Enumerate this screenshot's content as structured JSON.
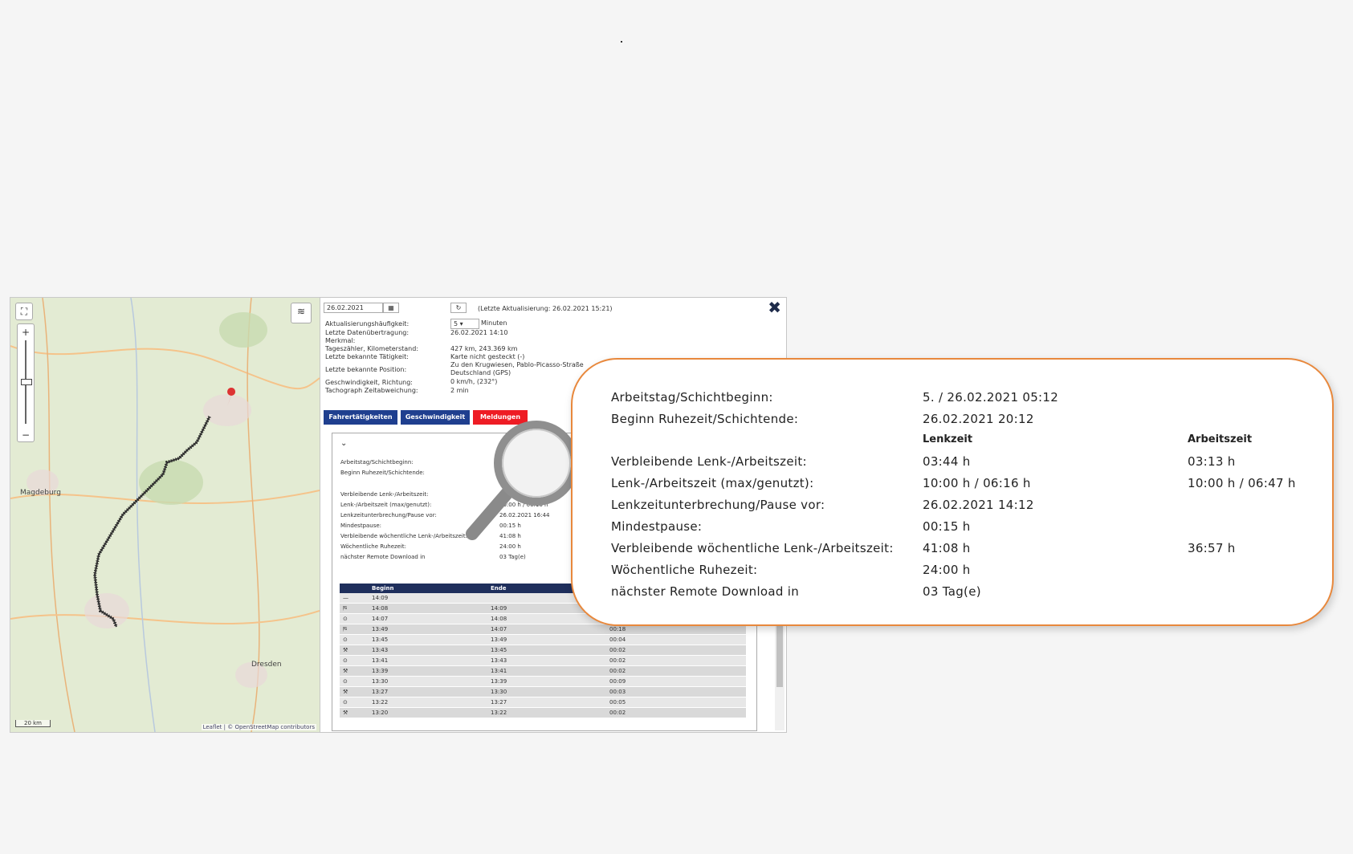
{
  "map": {
    "labels": {
      "magdeburg": "Magdeburg",
      "dresden": "Dresden"
    },
    "attribution": "Leaflet | © OpenStreetMap contributors",
    "scale": "20 km"
  },
  "panel": {
    "date_value": "26.02.2021",
    "last_update": "(Letzte Aktualisierung: 26.02.2021 15:21)",
    "refresh_value": "5",
    "refresh_unit": "Minuten",
    "info": [
      {
        "label": "Aktualisierungshäufigkeit:",
        "value": ""
      },
      {
        "label": "Letzte Datenübertragung:",
        "value": "26.02.2021 14:10"
      },
      {
        "label": "Merkmal:",
        "value": ""
      },
      {
        "label": "Tageszähler, Kilometerstand:",
        "value": "427 km, 243.369 km"
      },
      {
        "label": "Letzte bekannte Tätigkeit:",
        "value": "Karte nicht gesteckt (-)"
      },
      {
        "label": "",
        "value": "Zu den Krugwiesen, Pablo-Picasso-Straße"
      },
      {
        "label": "Letzte bekannte Position:",
        "value": "Deutschland (GPS)"
      },
      {
        "label": "Geschwindigkeit, Richtung:",
        "value": "0 km/h, (232°)"
      },
      {
        "label": "Tachograph Zeitabweichung:",
        "value": "2 min"
      }
    ],
    "tabs": {
      "fahrer": "Fahrertätigkeiten",
      "geschw": "Geschwindigkeit",
      "meldungen": "Meldungen"
    },
    "inner": [
      {
        "label": "Arbeitstag/Schichtbeginn:",
        "value": ""
      },
      {
        "label": "Beginn Ruhezeit/Schichtende:",
        "value": ""
      },
      {
        "label": "Verbleibende Lenk-/Arbeitszeit:",
        "value": "03:44 h"
      },
      {
        "label": "Lenk-/Arbeitszeit (max/genutzt):",
        "value": "10:00 h / 06:16 h"
      },
      {
        "label": "Lenkzeitunterbrechung/Pause vor:",
        "value": "26.02.2021 16:44"
      },
      {
        "label": "Mindestpause:",
        "value": "00:15 h"
      },
      {
        "label": "Verbleibende wöchentliche Lenk-/Arbeitszeit:",
        "value": "41:08 h"
      },
      {
        "label": "Wöchentliche Ruhezeit:",
        "value": "24:00 h"
      },
      {
        "label": "nächster Remote Download in",
        "value": "03 Tag(e)"
      }
    ],
    "table": {
      "headers": [
        "",
        "Beginn",
        "Ende",
        ""
      ],
      "rows": [
        [
          "—",
          "14:09",
          "",
          ""
        ],
        [
          "⛿",
          "14:08",
          "14:09",
          ""
        ],
        [
          "⊙",
          "14:07",
          "14:08",
          ""
        ],
        [
          "⛿",
          "13:49",
          "14:07",
          "00:18"
        ],
        [
          "⊙",
          "13:45",
          "13:49",
          "00:04"
        ],
        [
          "⚒",
          "13:43",
          "13:45",
          "00:02"
        ],
        [
          "⊙",
          "13:41",
          "13:43",
          "00:02"
        ],
        [
          "⚒",
          "13:39",
          "13:41",
          "00:02"
        ],
        [
          "⊙",
          "13:30",
          "13:39",
          "00:09"
        ],
        [
          "⚒",
          "13:27",
          "13:30",
          "00:03"
        ],
        [
          "⊙",
          "13:22",
          "13:27",
          "00:05"
        ],
        [
          "⚒",
          "13:20",
          "13:22",
          "00:02"
        ]
      ]
    }
  },
  "callout": {
    "col_head_1": "Lenkzeit",
    "col_head_2": "Arbeitszeit",
    "rows": [
      {
        "label": "Arbeitstag/Schichtbeginn:",
        "v1": "5. / 26.02.2021 05:12",
        "v2": ""
      },
      {
        "label": "Beginn Ruhezeit/Schichtende:",
        "v1": "26.02.2021 20:12",
        "v2": ""
      },
      {
        "label": "Verbleibende Lenk-/Arbeitszeit:",
        "v1": "03:44 h",
        "v2": "03:13 h"
      },
      {
        "label": "Lenk-/Arbeitszeit (max/genutzt):",
        "v1": "10:00 h / 06:16 h",
        "v2": "10:00 h / 06:47 h"
      },
      {
        "label": "Lenkzeitunterbrechung/Pause vor:",
        "v1": "26.02.2021 14:12",
        "v2": ""
      },
      {
        "label": "Mindestpause:",
        "v1": "00:15 h",
        "v2": ""
      },
      {
        "label": "Verbleibende wöchentliche Lenk-/Arbeitszeit:",
        "v1": "41:08 h",
        "v2": "36:57 h"
      },
      {
        "label": "Wöchentliche Ruhezeit:",
        "v1": "24:00 h",
        "v2": ""
      },
      {
        "label": "nächster Remote Download in",
        "v1": "03 Tag(e)",
        "v2": ""
      }
    ]
  },
  "colors": {
    "accent_orange": "#e8883c",
    "tab_blue": "#1f3f8f",
    "tab_red": "#ee1c24",
    "table_head": "#1f2f5c"
  }
}
